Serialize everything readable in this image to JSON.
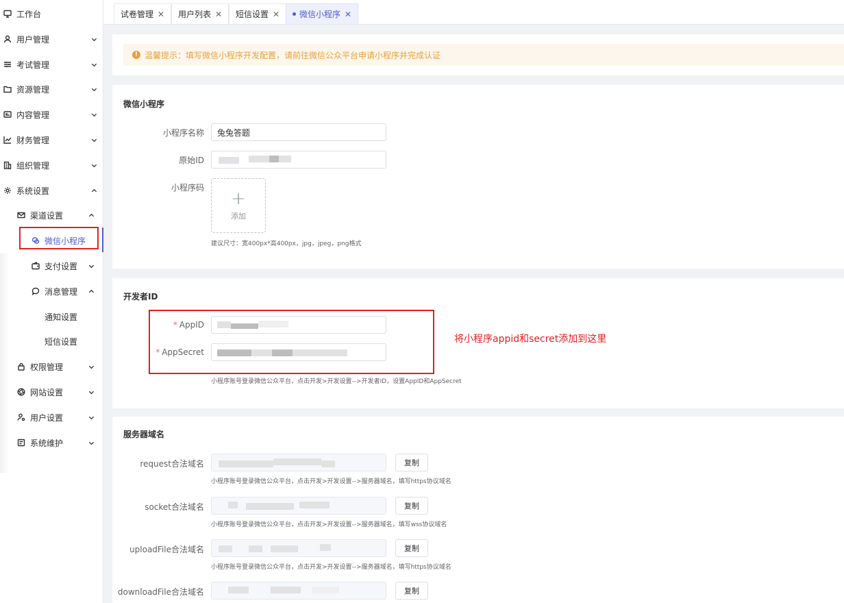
{
  "sidebar": {
    "items": [
      {
        "label": "工作台",
        "icon": "monitor-icon"
      },
      {
        "label": "用户管理",
        "icon": "user-icon"
      },
      {
        "label": "考试管理",
        "icon": "sliders-icon"
      },
      {
        "label": "资源管理",
        "icon": "folder-icon"
      },
      {
        "label": "内容管理",
        "icon": "content-icon"
      },
      {
        "label": "财务管理",
        "icon": "chart-icon"
      },
      {
        "label": "组织管理",
        "icon": "building-icon"
      },
      {
        "label": "系统设置",
        "icon": "gear-icon"
      }
    ],
    "channel": {
      "label": "渠道设置",
      "icon": "mail-icon"
    },
    "wechat_mini": {
      "label": "微信小程序",
      "icon": "wechat-icon"
    },
    "payment": {
      "label": "支付设置",
      "icon": "wallet-icon"
    },
    "message": {
      "label": "消息管理",
      "icon": "chat-icon"
    },
    "notify": {
      "label": "通知设置"
    },
    "sms": {
      "label": "短信设置"
    },
    "lower_items": [
      {
        "label": "权限管理",
        "icon": "lock-icon"
      },
      {
        "label": "网站设置",
        "icon": "aperture-icon"
      },
      {
        "label": "用户设置",
        "icon": "user-settings-icon"
      },
      {
        "label": "系统维护",
        "icon": "maintenance-icon"
      }
    ]
  },
  "tabs": [
    {
      "label": "试卷管理",
      "close": "✕"
    },
    {
      "label": "用户列表",
      "close": "✕"
    },
    {
      "label": "短信设置",
      "close": "✕"
    },
    {
      "label": "微信小程序",
      "close": "✕",
      "active": true
    }
  ],
  "notice": {
    "text": "温馨提示：填写微信小程序开发配置，请前往微信公众平台申请小程序并完成认证",
    "icon_glyph": "!"
  },
  "mini_program": {
    "title": "微信小程序",
    "name_label": "小程序名称",
    "name_value": "兔兔答题",
    "origin_id_label": "原始ID",
    "code_label": "小程序码",
    "upload_plus": "+",
    "upload_text": "添加",
    "size_hint": "建议尺寸：宽400px*高400px，jpg，jpeg，png格式"
  },
  "developer": {
    "title": "开发者ID",
    "required_mark": "*",
    "appid_label": "AppID",
    "secret_label": "AppSecret",
    "hint": "小程序账号登录微信公众平台，点击开发>开发设置-->开发者ID，设置AppID和AppSecret"
  },
  "annotation": "将小程序appid和secret添加到这里",
  "server": {
    "title": "服务器域名",
    "copy_label": "复制",
    "rows": [
      {
        "label": "request合法域名",
        "hint": "小程序账号登录微信公众平台，点击开发>开发设置-->服务器域名，填写https协议域名"
      },
      {
        "label": "socket合法域名",
        "hint": "小程序账号登录微信公众平台，点击开发>开发设置-->服务器域名，填写wss协议域名"
      },
      {
        "label": "uploadFile合法域名",
        "hint": "小程序账号登录微信公众平台，点击开发>开发设置-->服务器域名，填写https协议域名"
      },
      {
        "label": "downloadFile合法域名",
        "hint": ""
      }
    ]
  },
  "colors": {
    "accent": "#4f5bd5",
    "warning": "#e6a23c",
    "annotation": "#e02020"
  }
}
